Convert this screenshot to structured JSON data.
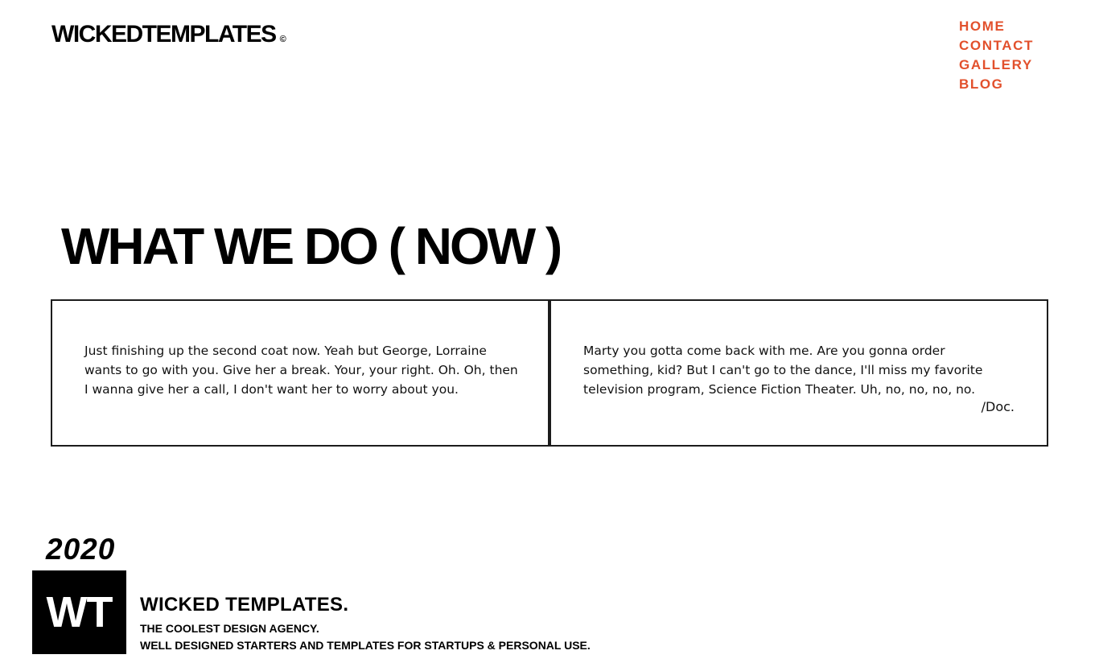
{
  "header": {
    "brand": "WICKEDTEMPLATES",
    "brand_mark": "©",
    "nav": [
      {
        "label": "HOME"
      },
      {
        "label": "CONTACT"
      },
      {
        "label": "GALLERY"
      },
      {
        "label": "BLOG"
      }
    ]
  },
  "main": {
    "headline": "WHAT WE DO ( NOW )",
    "cards": [
      {
        "text": "Just finishing up the second coat now. Yeah but George, Lorraine wants to go with you. Give her a break. Your, your right. Oh. Oh, then I wanna give her a call, I don't want her to worry about you."
      },
      {
        "text": "Marty you gotta come back with me. Are you gonna order something, kid? But I can't go to the dance, I'll miss my favorite television program, Science Fiction Theater. Uh, no, no, no, no.",
        "signature": "/Doc."
      }
    ]
  },
  "footer": {
    "year": "2020",
    "logo_text": "WT",
    "company_name": "WICKED TEMPLATES.",
    "tagline_1": "THE COOLEST DESIGN AGENCY.",
    "tagline_2": "WELL DESIGNED STARTERS AND TEMPLATES FOR STARTUPS & PERSONAL USE."
  },
  "colors": {
    "accent": "#e2502c",
    "text": "#000000",
    "border": "#1c1c1c",
    "background": "#ffffff"
  }
}
